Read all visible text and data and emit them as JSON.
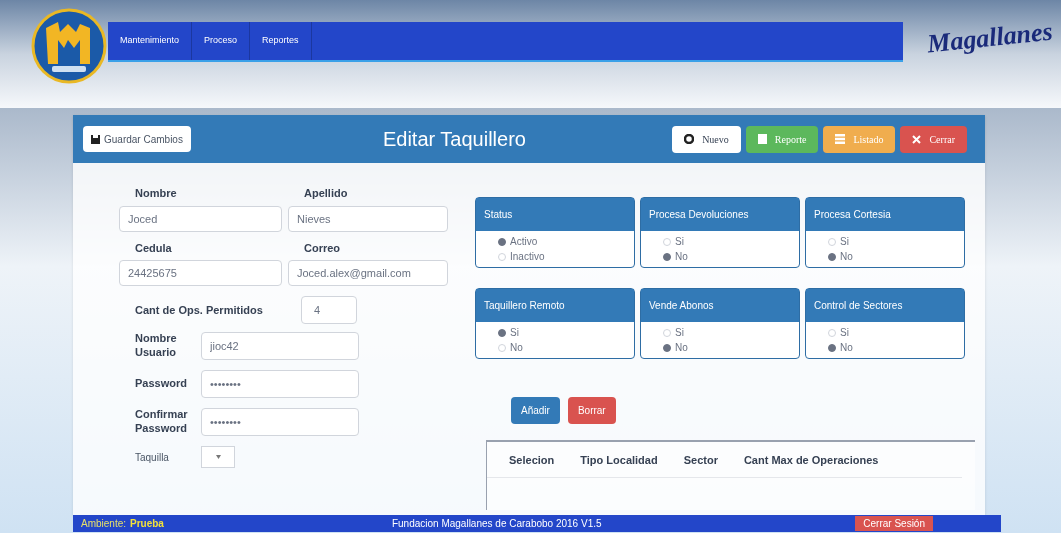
{
  "nav": {
    "items": [
      "Mantenimiento",
      "Proceso",
      "Reportes"
    ]
  },
  "brand": "Magallanes",
  "panel": {
    "save_button": "Guardar Cambios",
    "title": "Editar Taquillero",
    "actions": [
      {
        "label": "Nuevo",
        "kind": "light"
      },
      {
        "label": "Reporte",
        "kind": "success"
      },
      {
        "label": "Listado",
        "kind": "warning"
      },
      {
        "label": "Cerrar",
        "kind": "danger"
      }
    ]
  },
  "form": {
    "nombre": {
      "label": "Nombre",
      "value": "Joced"
    },
    "apellido": {
      "label": "Apellido",
      "value": "Nieves"
    },
    "cedula": {
      "label": "Cedula",
      "value": "24425675"
    },
    "correo": {
      "label": "Correo",
      "value": "Joced.alex@gmail.com"
    },
    "cant_ops": {
      "label": "Cant de Ops. Permitidos",
      "value": "4"
    },
    "usuario": {
      "label": "Nombre Usuario",
      "value": "jioc42"
    },
    "password": {
      "label": "Password",
      "value": "••••••••"
    },
    "confirmar": {
      "label": "Confirmar Password",
      "value": "••••••••"
    },
    "taquilla": {
      "label": "Taquilla"
    }
  },
  "option_groups": [
    {
      "title": "Status",
      "options": [
        {
          "label": "Activo",
          "selected": true
        },
        {
          "label": "Inactivo",
          "selected": false
        }
      ]
    },
    {
      "title": "Procesa Devoluciones",
      "options": [
        {
          "label": "Si",
          "selected": false
        },
        {
          "label": "No",
          "selected": true
        }
      ]
    },
    {
      "title": "Procesa Cortesia",
      "options": [
        {
          "label": "Si",
          "selected": false
        },
        {
          "label": "No",
          "selected": true
        }
      ]
    },
    {
      "title": "Taquillero Remoto",
      "options": [
        {
          "label": "Si",
          "selected": true
        },
        {
          "label": "No",
          "selected": false
        }
      ]
    },
    {
      "title": "Vende Abonos",
      "options": [
        {
          "label": "Si",
          "selected": false
        },
        {
          "label": "No",
          "selected": true
        }
      ]
    },
    {
      "title": "Control de Sectores",
      "options": [
        {
          "label": "Si",
          "selected": false
        },
        {
          "label": "No",
          "selected": true
        }
      ]
    }
  ],
  "table_buttons": [
    {
      "label": "Añadir",
      "kind": "primary"
    },
    {
      "label": "Borrar",
      "kind": "danger"
    }
  ],
  "table": {
    "columns": [
      "Selecion",
      "Tipo Localidad",
      "Sector",
      "Cant Max de Operaciones"
    ]
  },
  "status_bar": {
    "environment_label": "Ambiente:",
    "environment": "Prueba",
    "footer_text": "Fundacion Magallanes de Carabobo 2016 V1.5",
    "logout": "Cerrar Sesión"
  }
}
